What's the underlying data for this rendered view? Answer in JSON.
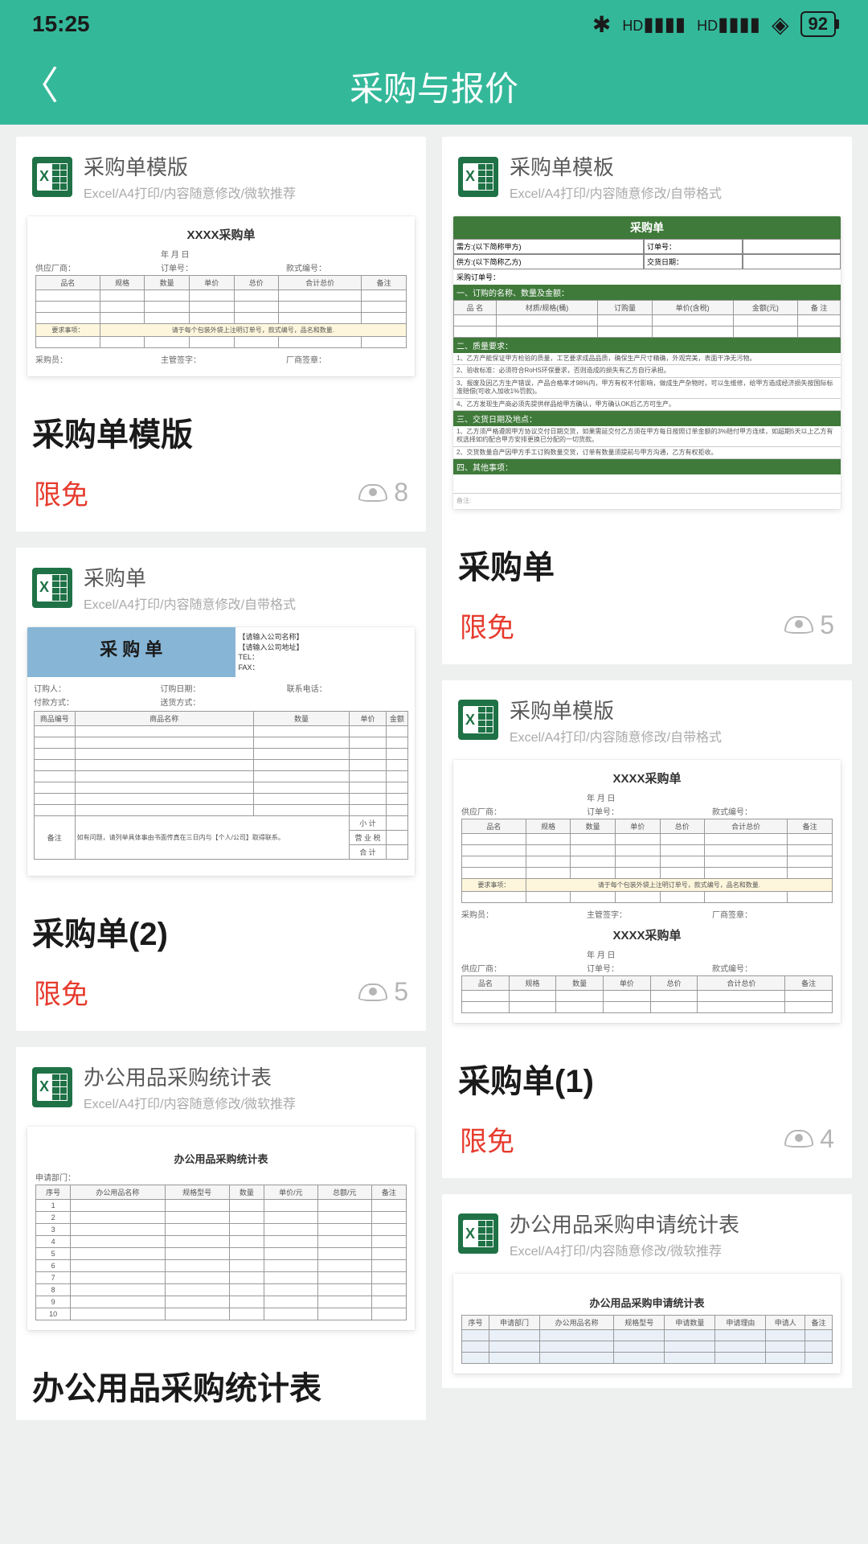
{
  "status": {
    "time": "15:25",
    "battery": "92"
  },
  "nav": {
    "title": "采购与报价"
  },
  "cards": [
    {
      "header_title": "采购单模版",
      "header_sub": "Excel/A4打印/内容随意修改/微软推荐",
      "title": "采购单模版",
      "tag": "限免",
      "views": "8",
      "preview_title": "XXXX采购单",
      "cols": [
        "品名",
        "规格",
        "数量",
        "单价",
        "总价",
        "合计总价",
        "备注"
      ]
    },
    {
      "header_title": "采购单",
      "header_sub": "Excel/A4打印/内容随意修改/自带格式",
      "title": "采购单(2)",
      "tag": "限免",
      "views": "5",
      "preview_title": "采 购 单",
      "cols": [
        "商品编号",
        "商品名称",
        "数量",
        "单价",
        "金额"
      ]
    },
    {
      "header_title": "办公用品采购统计表",
      "header_sub": "Excel/A4打印/内容随意修改/微软推荐",
      "title": "办公用品采购统计表",
      "preview_title": "办公用品采购统计表",
      "cols": [
        "序号",
        "办公用品名称",
        "规格型号",
        "数量",
        "单价/元",
        "总额/元",
        "备注"
      ]
    },
    {
      "header_title": "采购单模板",
      "header_sub": "Excel/A4打印/内容随意修改/自带格式",
      "title": "采购单",
      "tag": "限免",
      "views": "5",
      "preview_title": "采购单",
      "rows_a": [
        "需方:(以下简称甲方)",
        "供方:(以下简称乙方)"
      ],
      "cols": [
        "品 名",
        "材质/规格(桶)",
        "订购量",
        "单价(含税)",
        "金额(元)",
        "备 注"
      ]
    },
    {
      "header_title": "采购单模版",
      "header_sub": "Excel/A4打印/内容随意修改/自带格式",
      "title": "采购单(1)",
      "tag": "限免",
      "views": "4",
      "preview_title": "XXXX采购单",
      "cols": [
        "品名",
        "规格",
        "数量",
        "单价",
        "总价",
        "合计总价",
        "备注"
      ]
    },
    {
      "header_title": "办公用品采购申请统计表",
      "header_sub": "Excel/A4打印/内容随意修改/微软推荐",
      "preview_title": "办公用品采购申请统计表",
      "cols": [
        "序号",
        "申请部门",
        "办公用品名称",
        "规格型号",
        "申请数量",
        "申请理由",
        "申请人",
        "备注"
      ]
    }
  ],
  "labels": {
    "date": "年 月 日",
    "supplier": "供应厂商：",
    "order_no": "订单号：",
    "style_no": "款式编号：",
    "note_label": "要求事项：",
    "note_text": "请于每个包装外袋上注明订单号，款式编号，品名和数量.",
    "purchaser": "采购员：",
    "signer": "主管签字：",
    "vendor_sign": "厂商签章：",
    "company_name": "【请输入公司名称】",
    "company_addr": "【请输入公司地址】",
    "tel": "TEL：",
    "fax": "FAX：",
    "orderer": "订购人：",
    "order_date": "订购日期：",
    "contact": "联系电话：",
    "pay_method": "付款方式：",
    "ship_method": "送货方式：",
    "remark": "备注",
    "remark_text": "如有问题，请列举具体事由书面传真在三日内与【个人/公司】取得联系。",
    "subtotal": "小 计",
    "tax": "营 业 税",
    "total": "合 计",
    "dept": "申请部门：",
    "sec1": "一、订购的名称、数量及金额：",
    "sec2": "二、质量要求：",
    "sec3": "三、交货日期及地点：",
    "sec4": "四、其他事项：",
    "q1": "1、乙方产能保证甲方检验的质量，工艺要求成品品质，确保生产尺寸精确，外观完美，表面干净无污物。",
    "q2": "2、验收标准：必须符合RoHS环保要求，否则造成的损失有乙方自行承担。",
    "q3": "3、报废及因乙方生产错误，产品合格率才98%内，甲方有权不付影响，做成生产杂物时，可以生维修，给甲方造成经济损失按国际标准赔偿(可收入加收1%罚款)。",
    "q4": "4、乙方发现生产商必须先提供样品给甲方确认，甲方确认OK后乙方可生产。",
    "d1": "1、乙方须严格遵照甲方协议交付日期交货，如果需延交付乙方须在甲方每日按照订单金额的3%赔付甲方连续，如超期5天以上乙方有权选择如约配合甲方安排更换已分配的一切货款。",
    "d2": "2、交货数量自产因甲方手工订购数量交货，订单有数量须提前与甲方沟通，乙方有权拒收。"
  }
}
